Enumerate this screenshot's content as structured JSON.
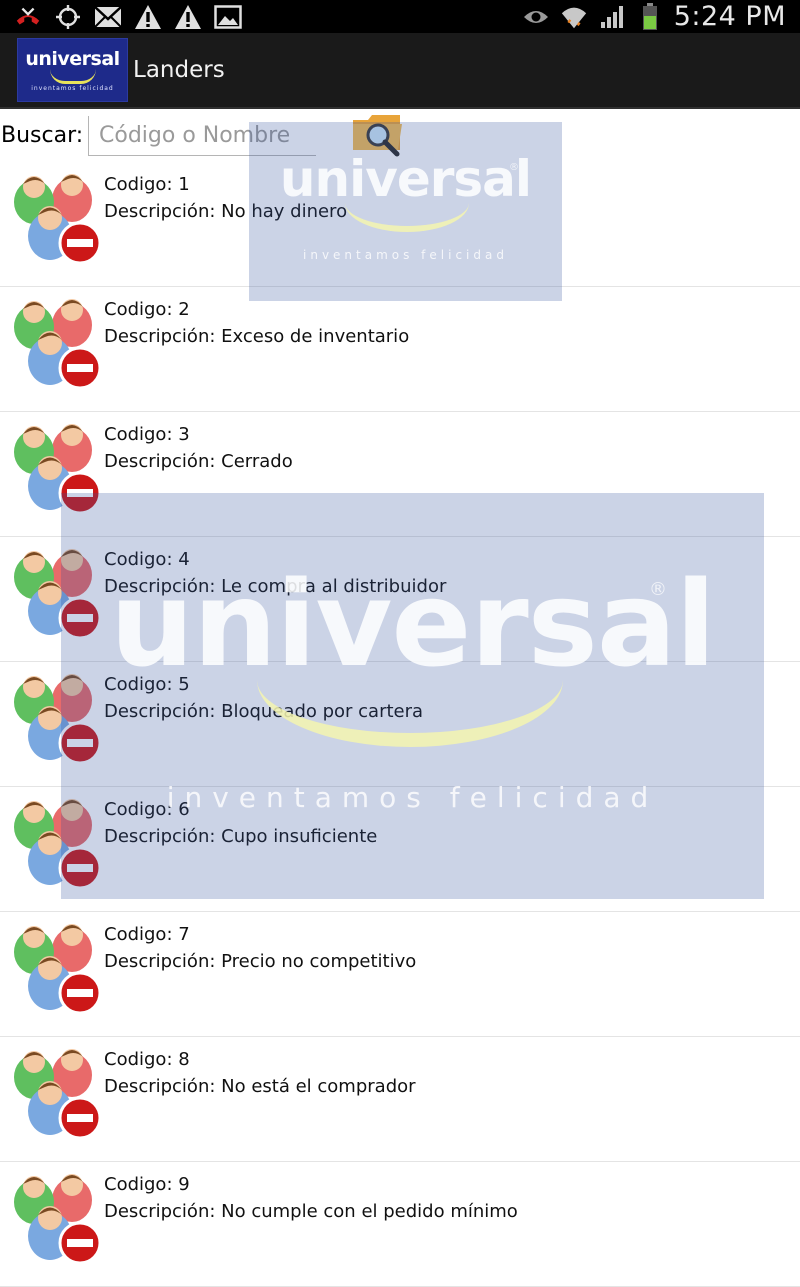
{
  "status_bar": {
    "icons": [
      "missed-call-icon",
      "gps-icon",
      "mail-icon",
      "warning-icon",
      "warning-icon",
      "picture-icon"
    ],
    "right_icons": [
      "eye-icon",
      "wifi-icon",
      "signal-icon",
      "battery-icon"
    ],
    "time": "5:24 PM"
  },
  "app_bar": {
    "logo": {
      "word": "universal",
      "tagline": "inventamos felicidad"
    },
    "title": "Landers"
  },
  "search": {
    "label": "Buscar:",
    "placeholder": "Código o Nombre",
    "value": "",
    "button_icon": "folder-search-icon"
  },
  "items": [
    {
      "code": "Codigo: 1",
      "description": "Descripción: No hay dinero"
    },
    {
      "code": "Codigo: 2",
      "description": "Descripción: Exceso de inventario"
    },
    {
      "code": "Codigo: 3",
      "description": "Descripción: Cerrado"
    },
    {
      "code": "Codigo: 4",
      "description": "Descripción: Le compra al distribuidor"
    },
    {
      "code": "Codigo: 5",
      "description": "Descripción: Bloqueado por cartera"
    },
    {
      "code": "Codigo: 6",
      "description": "Descripción: Cupo insuficiente"
    },
    {
      "code": "Codigo: 7",
      "description": "Descripción: Precio no competitivo"
    },
    {
      "code": "Codigo: 8",
      "description": "Descripción: No está el comprador"
    },
    {
      "code": "Codigo: 9",
      "description": "Descripción: No cumple con el pedido mínimo"
    }
  ],
  "watermark": {
    "word": "universal",
    "tagline": "inventamos felicidad"
  },
  "colors": {
    "status_bar": "#000000",
    "action_bar": "#1a1a1a",
    "logo_bg": "#1e2a8a",
    "watermark": "#3755a0",
    "no_sign": "#d01818"
  }
}
